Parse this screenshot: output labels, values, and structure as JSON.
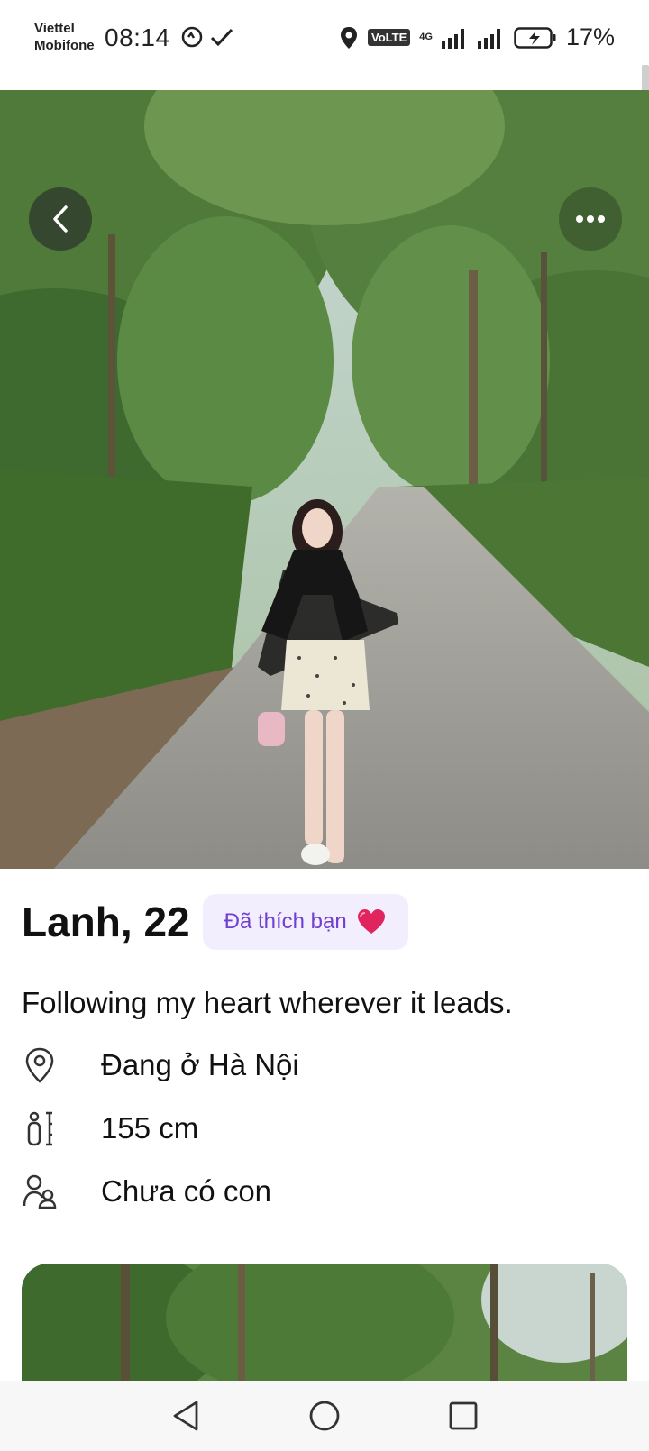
{
  "status_bar": {
    "carrier_line1": "Viettel",
    "carrier_line2": "Mobifone",
    "time": "08:14",
    "volte": "VoLTE",
    "network": "4G",
    "battery_percent": "17%"
  },
  "hero": {
    "back_icon": "chevron-left-icon",
    "more_icon": "more-horizontal-icon"
  },
  "profile": {
    "name_age": "Lanh, 22",
    "liked_badge": "Đã thích bạn",
    "bio": "Following my heart wherever it leads.",
    "location": "Đang ở Hà Nội",
    "height": "155 cm",
    "children": "Chưa có con"
  },
  "colors": {
    "badge_bg": "#f3eefe",
    "badge_text": "#6f3fd0",
    "heart": "#e0245e"
  }
}
